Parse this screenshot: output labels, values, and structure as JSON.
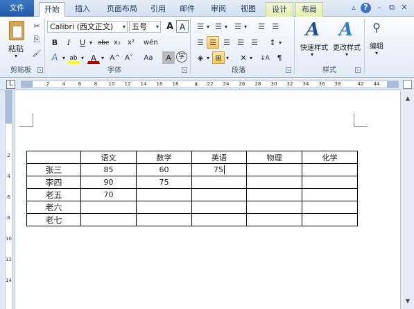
{
  "tabs": [
    {
      "label": "文件"
    },
    {
      "label": "开始"
    },
    {
      "label": "插入"
    },
    {
      "label": "页面布局"
    },
    {
      "label": "引用"
    },
    {
      "label": "邮件"
    },
    {
      "label": "审阅"
    },
    {
      "label": "视图"
    },
    {
      "label": "设计"
    },
    {
      "label": "布局"
    }
  ],
  "window_controls": {
    "minimize": "▵",
    "help": "?",
    "restore": "⧉",
    "close": "✕"
  },
  "ribbon": {
    "clipboard": {
      "paste": "粘贴",
      "label": "剪贴板",
      "cut_icon": "✂",
      "copy_icon": "⎘",
      "brush_icon": "🖌"
    },
    "font": {
      "name": "Calibri (西文正文)",
      "size": "五号",
      "grow": "A",
      "shrink": "A",
      "clear_icon": "A",
      "wen_icon": "wén",
      "a_icon": "A",
      "bold": "B",
      "italic": "I",
      "underline": "U",
      "strike": "abc",
      "sub": "x₂",
      "sup": "x²",
      "highlight": "ab",
      "color": "A",
      "grow2": "A^",
      "shrink2": "Aˇ",
      "aa": "Aa",
      "shade": "A",
      "circle": "字",
      "label": "字体"
    },
    "paragraph": {
      "label": "段落",
      "bullet": "☰",
      "number": "☰",
      "multi": "☰",
      "dec_indent": "☰",
      "inc_indent": "☰",
      "align_left": "☰",
      "center": "☰",
      "align_right": "☰",
      "justify": "☰",
      "distribute": "☰",
      "line_spacing": "↕",
      "shading": "◈",
      "border": "⊞",
      "asian": "✕",
      "sort": "↓A",
      "pilcrow": "¶"
    },
    "styles": {
      "quick": "快速样式",
      "change": "更改样式",
      "label": "样式"
    },
    "editing": {
      "label": "编辑"
    }
  },
  "ruler": {
    "numbers": [
      "2",
      "4",
      "6",
      "8",
      "10",
      "12",
      "14",
      "16",
      "18",
      "22",
      "24",
      "26",
      "28",
      "30",
      "32",
      "34",
      "36",
      "38",
      "42",
      "44"
    ],
    "tab_button": "L"
  },
  "vruler": {
    "numbers": [
      "2",
      "4",
      "6",
      "8",
      "10",
      "12",
      "14"
    ]
  },
  "table": {
    "headers": [
      "",
      "语文",
      "数学",
      "英语",
      "物理",
      "化学"
    ],
    "rows": [
      [
        "张三",
        "85",
        "60",
        "75",
        "",
        ""
      ],
      [
        "李四",
        "90",
        "75",
        "",
        "",
        ""
      ],
      [
        "老五",
        "70",
        "",
        "",
        "",
        ""
      ],
      [
        "老六",
        "",
        "",
        "",
        "",
        ""
      ],
      [
        "老七",
        "",
        "",
        "",
        "",
        ""
      ]
    ]
  },
  "scroll": {
    "up": "▲",
    "down": "▼"
  },
  "colors": {
    "accent": "#2b5797",
    "highlight_yellow": "#ffff00",
    "font_red": "#c00000"
  }
}
